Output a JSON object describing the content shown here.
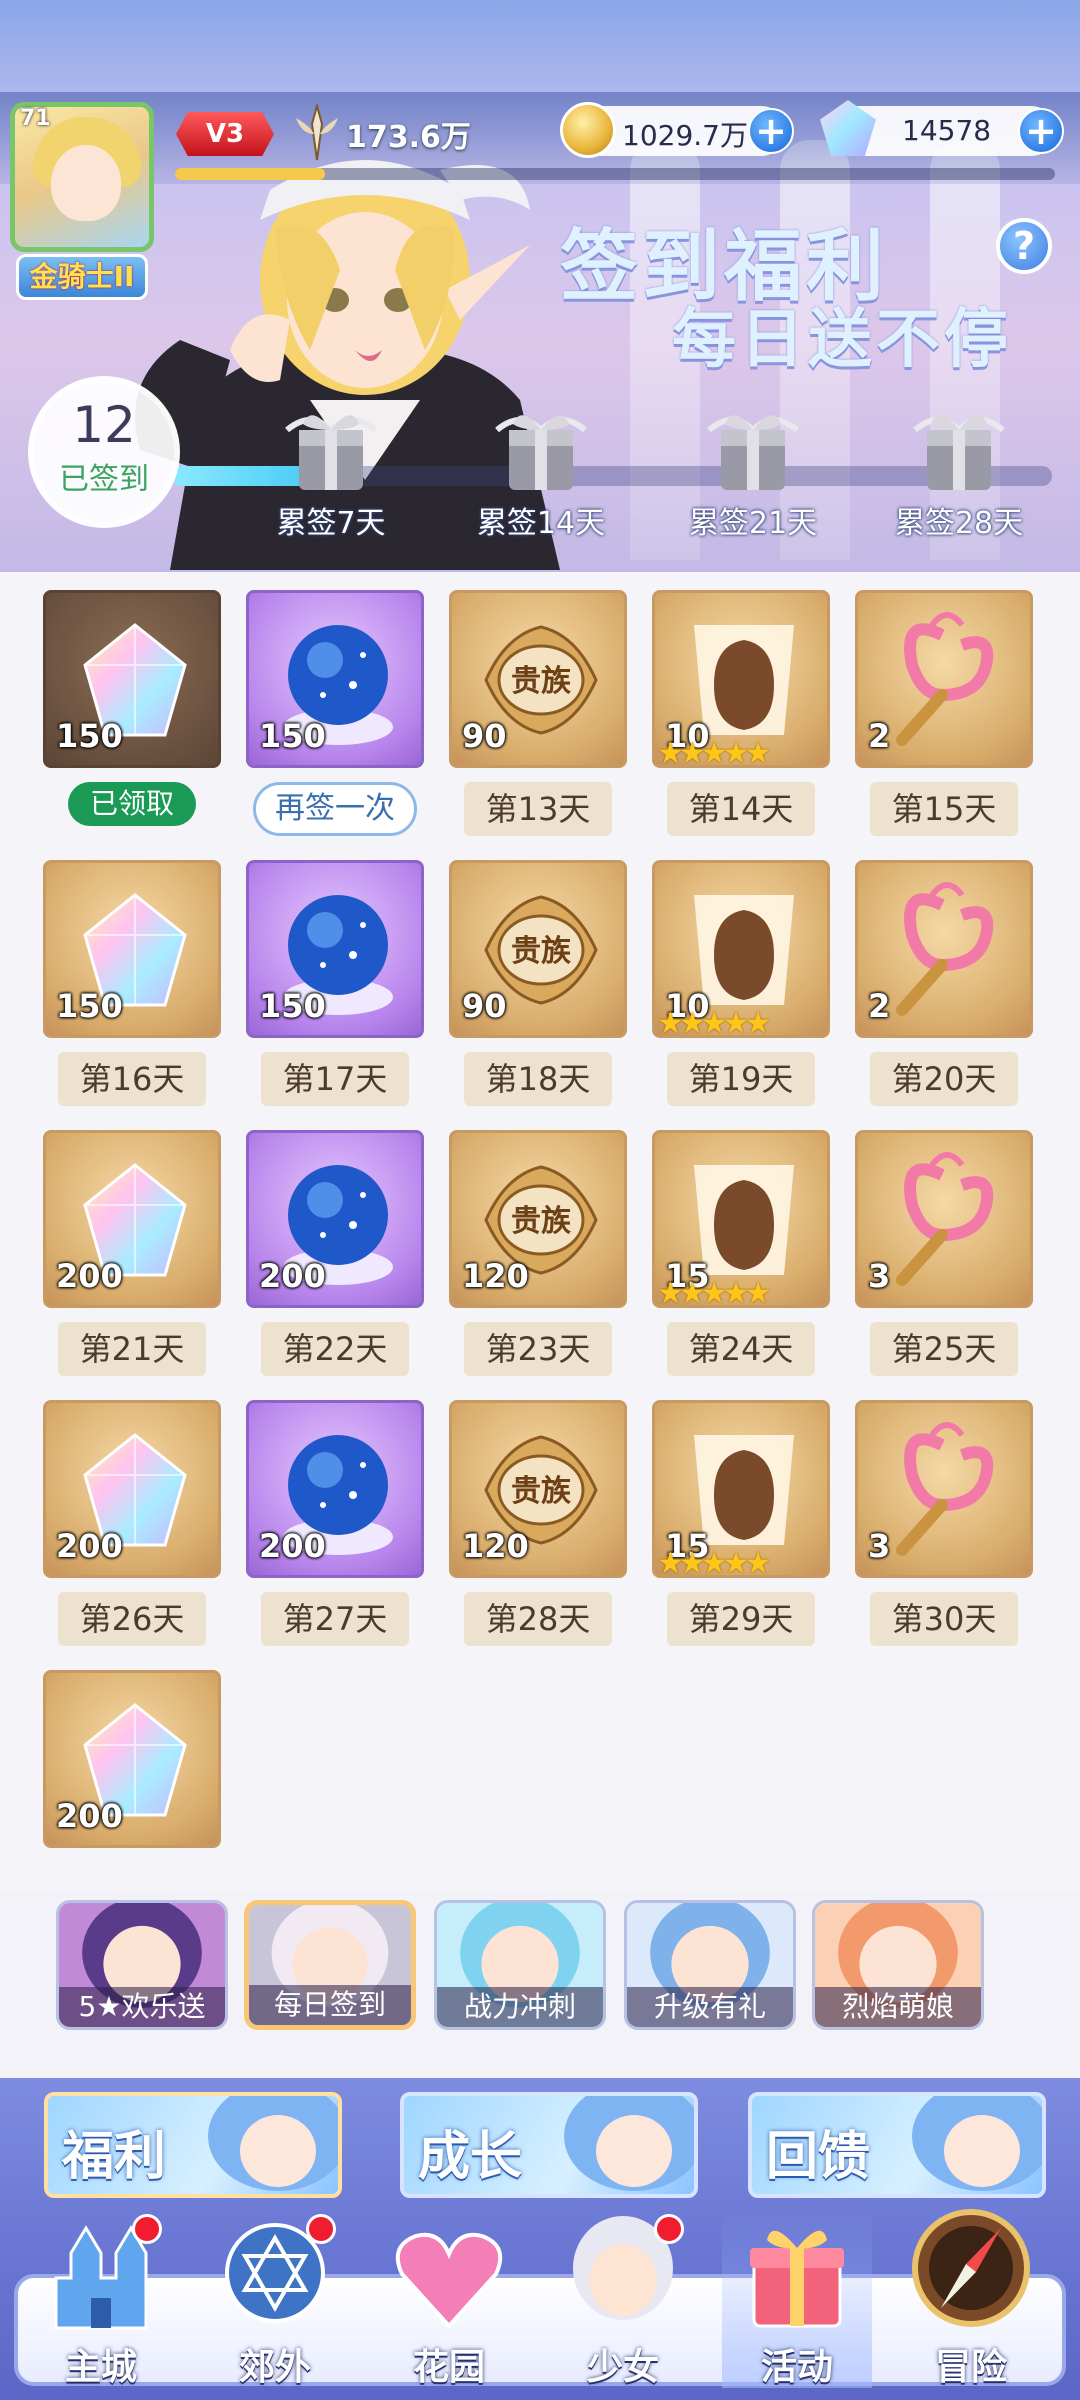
{
  "status": {
    "level": "71",
    "rank": "金骑士II",
    "vip": "V3",
    "power": "173.6万",
    "xp_progress": 0.17,
    "gold": "1029.7万",
    "diamonds": "14578"
  },
  "banner": {
    "title_line1": "签到福利",
    "title_line2": "每日送不停",
    "signed_days": "12",
    "signed_label": "已签到",
    "cumulative_progress": 0.21,
    "milestones": [
      "累签7天",
      "累签14天",
      "累签21天",
      "累签28天"
    ]
  },
  "rewards": [
    {
      "qty": "150",
      "item": "prism-crystal",
      "tile": "dark",
      "label": "已领取",
      "state": "claimed"
    },
    {
      "qty": "150",
      "item": "star-orb",
      "tile": "purple",
      "label": "再签一次",
      "state": "resign"
    },
    {
      "qty": "90",
      "item": "noble-badge",
      "tile": "gold",
      "label": "第13天",
      "state": "pending"
    },
    {
      "qty": "10",
      "item": "mystery-hero",
      "tile": "gold",
      "label": "第14天",
      "state": "pending",
      "stars": "★★★★★"
    },
    {
      "qty": "2",
      "item": "heart-wand",
      "tile": "gold",
      "label": "第15天",
      "state": "pending"
    },
    {
      "qty": "150",
      "item": "prism-crystal",
      "tile": "gold",
      "label": "第16天",
      "state": "pending"
    },
    {
      "qty": "150",
      "item": "star-orb",
      "tile": "purple",
      "label": "第17天",
      "state": "pending"
    },
    {
      "qty": "90",
      "item": "noble-badge",
      "tile": "gold",
      "label": "第18天",
      "state": "pending"
    },
    {
      "qty": "10",
      "item": "mystery-hero",
      "tile": "gold",
      "label": "第19天",
      "state": "pending",
      "stars": "★★★★★"
    },
    {
      "qty": "2",
      "item": "heart-wand",
      "tile": "gold",
      "label": "第20天",
      "state": "pending"
    },
    {
      "qty": "200",
      "item": "prism-crystal",
      "tile": "gold",
      "label": "第21天",
      "state": "pending"
    },
    {
      "qty": "200",
      "item": "star-orb",
      "tile": "purple",
      "label": "第22天",
      "state": "pending"
    },
    {
      "qty": "120",
      "item": "noble-badge",
      "tile": "gold",
      "label": "第23天",
      "state": "pending"
    },
    {
      "qty": "15",
      "item": "mystery-hero",
      "tile": "gold",
      "label": "第24天",
      "state": "pending",
      "stars": "★★★★★"
    },
    {
      "qty": "3",
      "item": "heart-wand",
      "tile": "gold",
      "label": "第25天",
      "state": "pending"
    },
    {
      "qty": "200",
      "item": "prism-crystal",
      "tile": "gold",
      "label": "第26天",
      "state": "pending"
    },
    {
      "qty": "200",
      "item": "star-orb",
      "tile": "purple",
      "label": "第27天",
      "state": "pending"
    },
    {
      "qty": "120",
      "item": "noble-badge",
      "tile": "gold",
      "label": "第28天",
      "state": "pending"
    },
    {
      "qty": "15",
      "item": "mystery-hero",
      "tile": "gold",
      "label": "第29天",
      "state": "pending",
      "stars": "★★★★★"
    },
    {
      "qty": "3",
      "item": "heart-wand",
      "tile": "gold",
      "label": "第30天",
      "state": "pending"
    },
    {
      "qty": "200",
      "item": "prism-crystal",
      "tile": "gold",
      "label": "",
      "state": "partial"
    }
  ],
  "noble_badge_text": "贵族",
  "events": [
    {
      "label": "5★欢乐送",
      "active": false
    },
    {
      "label": "每日签到",
      "active": true
    },
    {
      "label": "战力冲刺",
      "active": false
    },
    {
      "label": "升级有礼",
      "active": false
    },
    {
      "label": "烈焰萌娘",
      "active": false
    }
  ],
  "categories": [
    {
      "label": "福利",
      "active": true
    },
    {
      "label": "成长",
      "active": false
    },
    {
      "label": "回馈",
      "active": false
    }
  ],
  "nav": [
    {
      "label": "主城",
      "icon": "castle-icon",
      "badge": true
    },
    {
      "label": "郊外",
      "icon": "hexagram-icon",
      "badge": true
    },
    {
      "label": "花园",
      "icon": "heart-icon",
      "badge": false
    },
    {
      "label": "少女",
      "icon": "girl-icon",
      "badge": true
    },
    {
      "label": "活动",
      "icon": "gift-box-icon",
      "badge": false,
      "active": true
    },
    {
      "label": "冒险",
      "icon": "compass-icon",
      "badge": false
    }
  ],
  "colors": {
    "claimed": "#1a9a55",
    "badge": "#f01c2f",
    "progress": "#35c2f2"
  }
}
